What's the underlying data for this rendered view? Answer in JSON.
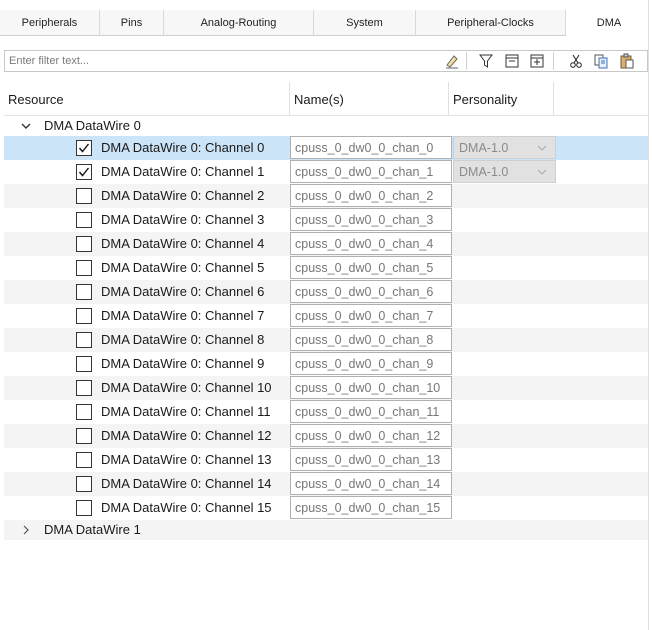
{
  "tabs": [
    {
      "label": "Peripherals",
      "active": false
    },
    {
      "label": "Pins",
      "active": false
    },
    {
      "label": "Analog-Routing",
      "active": false
    },
    {
      "label": "System",
      "active": false
    },
    {
      "label": "Peripheral-Clocks",
      "active": false
    },
    {
      "label": "DMA",
      "active": true
    }
  ],
  "filter": {
    "placeholder": "Enter filter text..."
  },
  "toolbar": {
    "icons": [
      "eraser-icon",
      "filter-icon",
      "collapse-all-icon",
      "expand-all-icon",
      "cut-icon",
      "copy-icon",
      "paste-icon"
    ]
  },
  "columns": {
    "resource": "Resource",
    "names": "Name(s)",
    "personality": "Personality"
  },
  "groups": [
    {
      "label": "DMA DataWire 0",
      "expanded": true,
      "channels": [
        {
          "label": "DMA DataWire 0: Channel 0",
          "checked": true,
          "name": "cpuss_0_dw0_0_chan_0",
          "personality": "DMA-1.0",
          "selected": true
        },
        {
          "label": "DMA DataWire 0: Channel 1",
          "checked": true,
          "name": "cpuss_0_dw0_0_chan_1",
          "personality": "DMA-1.0",
          "selected": false
        },
        {
          "label": "DMA DataWire 0: Channel 2",
          "checked": false,
          "name": "cpuss_0_dw0_0_chan_2",
          "personality": "",
          "selected": false
        },
        {
          "label": "DMA DataWire 0: Channel 3",
          "checked": false,
          "name": "cpuss_0_dw0_0_chan_3",
          "personality": "",
          "selected": false
        },
        {
          "label": "DMA DataWire 0: Channel 4",
          "checked": false,
          "name": "cpuss_0_dw0_0_chan_4",
          "personality": "",
          "selected": false
        },
        {
          "label": "DMA DataWire 0: Channel 5",
          "checked": false,
          "name": "cpuss_0_dw0_0_chan_5",
          "personality": "",
          "selected": false
        },
        {
          "label": "DMA DataWire 0: Channel 6",
          "checked": false,
          "name": "cpuss_0_dw0_0_chan_6",
          "personality": "",
          "selected": false
        },
        {
          "label": "DMA DataWire 0: Channel 7",
          "checked": false,
          "name": "cpuss_0_dw0_0_chan_7",
          "personality": "",
          "selected": false
        },
        {
          "label": "DMA DataWire 0: Channel 8",
          "checked": false,
          "name": "cpuss_0_dw0_0_chan_8",
          "personality": "",
          "selected": false
        },
        {
          "label": "DMA DataWire 0: Channel 9",
          "checked": false,
          "name": "cpuss_0_dw0_0_chan_9",
          "personality": "",
          "selected": false
        },
        {
          "label": "DMA DataWire 0: Channel 10",
          "checked": false,
          "name": "cpuss_0_dw0_0_chan_10",
          "personality": "",
          "selected": false
        },
        {
          "label": "DMA DataWire 0: Channel 11",
          "checked": false,
          "name": "cpuss_0_dw0_0_chan_11",
          "personality": "",
          "selected": false
        },
        {
          "label": "DMA DataWire 0: Channel 12",
          "checked": false,
          "name": "cpuss_0_dw0_0_chan_12",
          "personality": "",
          "selected": false
        },
        {
          "label": "DMA DataWire 0: Channel 13",
          "checked": false,
          "name": "cpuss_0_dw0_0_chan_13",
          "personality": "",
          "selected": false
        },
        {
          "label": "DMA DataWire 0: Channel 14",
          "checked": false,
          "name": "cpuss_0_dw0_0_chan_14",
          "personality": "",
          "selected": false
        },
        {
          "label": "DMA DataWire 0: Channel 15",
          "checked": false,
          "name": "cpuss_0_dw0_0_chan_15",
          "personality": "",
          "selected": false
        }
      ]
    },
    {
      "label": "DMA DataWire 1",
      "expanded": false,
      "channels": []
    }
  ],
  "colors": {
    "selected_row": "#cce4f7",
    "alt_row": "#f4f4f4",
    "disabled_field": "#e1e1e1"
  }
}
